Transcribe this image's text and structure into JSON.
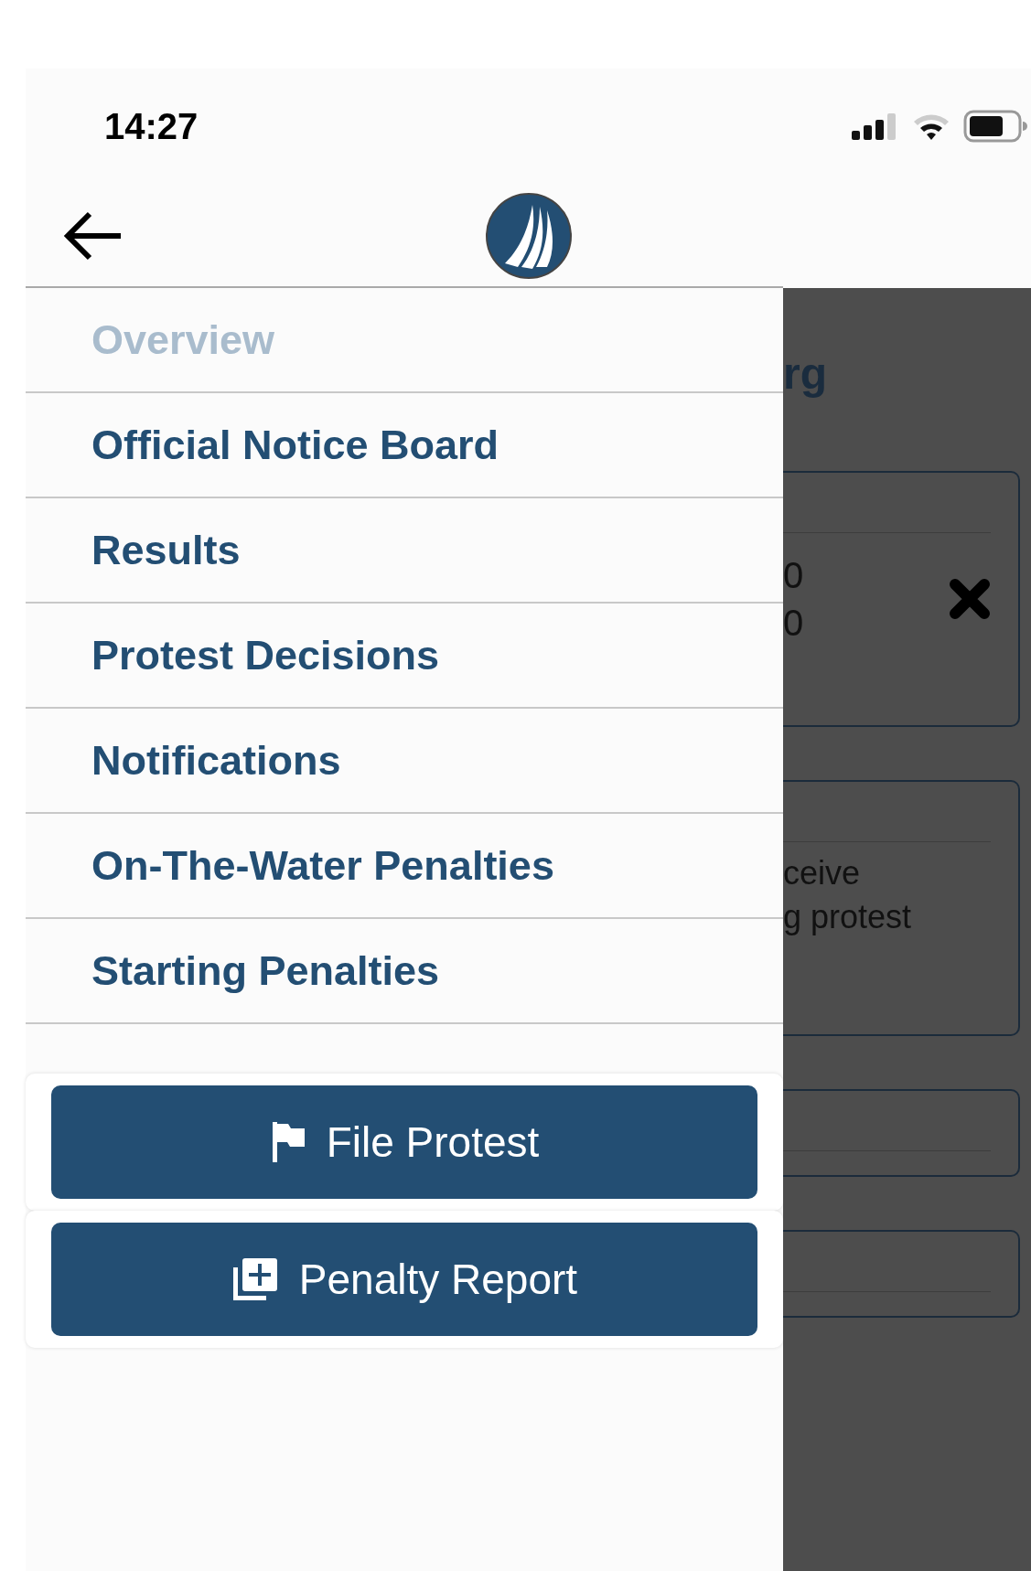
{
  "status_bar": {
    "time": "14:27"
  },
  "menu": {
    "items": [
      {
        "label": "Overview",
        "selected": true
      },
      {
        "label": "Official Notice Board",
        "selected": false
      },
      {
        "label": "Results",
        "selected": false
      },
      {
        "label": "Protest Decisions",
        "selected": false
      },
      {
        "label": "Notifications",
        "selected": false
      },
      {
        "label": "On-The-Water Penalties",
        "selected": false
      },
      {
        "label": "Starting Penalties",
        "selected": false
      }
    ]
  },
  "buttons": [
    {
      "label": "File Protest",
      "kind": "flag"
    },
    {
      "label": "Penalty Report",
      "kind": "add"
    }
  ],
  "background_page": {
    "title": "rg",
    "cards": [
      {
        "lines": [
          "0",
          "0"
        ],
        "close": true
      },
      {
        "lines": [
          "ceive",
          "g protest"
        ],
        "close": false
      },
      {
        "close": false
      },
      {
        "close": false
      }
    ]
  }
}
